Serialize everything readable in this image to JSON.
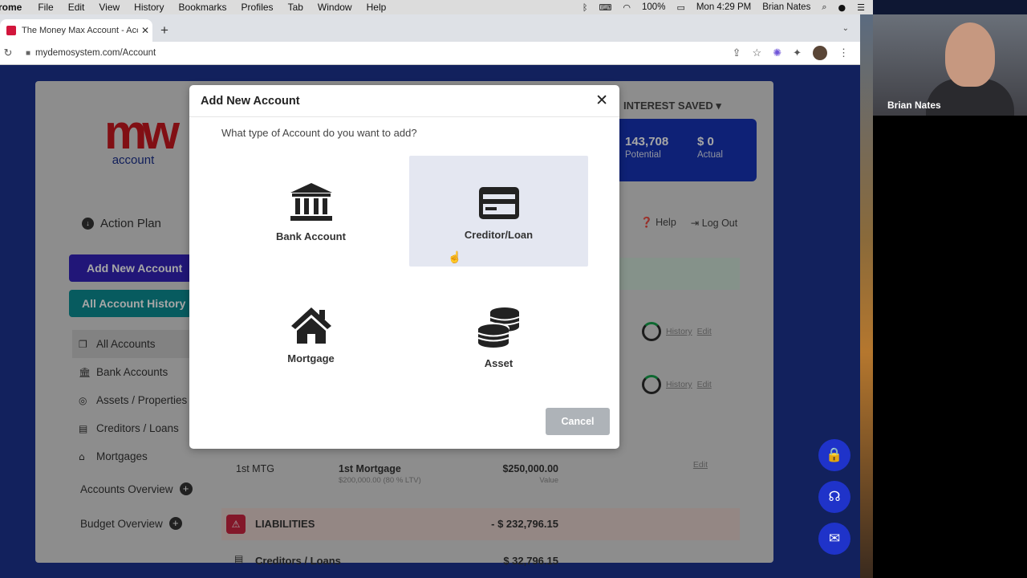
{
  "menubar": {
    "app_name": "Chrome",
    "items": [
      "File",
      "Edit",
      "View",
      "History",
      "Bookmarks",
      "Profiles",
      "Tab",
      "Window",
      "Help"
    ],
    "battery": "100%",
    "clock": "Mon 4:29 PM",
    "user": "Brian Nates"
  },
  "browser": {
    "tab_title": "The Money Max Account - Acc",
    "url": "mydemosystem.com/Account"
  },
  "page": {
    "logo_top": "mw",
    "logo_sub": "account",
    "action_plan": "Action Plan",
    "add_new_account": "Add New Account",
    "all_account_history": "All Account History",
    "nav": [
      {
        "label": "All Accounts",
        "icon": "copy-icon"
      },
      {
        "label": "Bank Accounts",
        "icon": "bank-icon"
      },
      {
        "label": "Assets / Properties",
        "icon": "coins-icon"
      },
      {
        "label": "Creditors / Loans",
        "icon": "card-icon"
      },
      {
        "label": "Mortgages",
        "icon": "home-icon"
      }
    ],
    "accounts_overview": "Accounts Overview",
    "budget_overview": "Budget Overview",
    "interest_saved": "INTEREST SAVED",
    "potential_value": "143,708",
    "potential_label": "Potential",
    "actual_value": "$ 0",
    "actual_label": "Actual",
    "help": "Help",
    "logout": "Log Out",
    "history_link": "History",
    "edit_link": "Edit",
    "mtg_col1": "1st MTG",
    "mtg_name": "1st Mortgage",
    "mtg_sub": "$200,000.00 (80 % LTV)",
    "mtg_value": "$250,000.00",
    "mtg_value_label": "Value",
    "liabilities_label": "LIABILITIES",
    "liabilities_amount": "- $ 232,796.15",
    "creditors_label": "Creditors / Loans",
    "creditors_amount": "$ 32,796.15"
  },
  "modal": {
    "title": "Add New Account",
    "question": "What type of Account do you want to add?",
    "options": [
      {
        "label": "Bank Account",
        "icon": "bank-icon"
      },
      {
        "label": "Creditor/Loan",
        "icon": "credit-card-icon"
      },
      {
        "label": "Mortgage",
        "icon": "house-icon"
      },
      {
        "label": "Asset",
        "icon": "coins-icon"
      }
    ],
    "cancel": "Cancel"
  },
  "video": {
    "participant": "Brian Nates"
  },
  "colors": {
    "primary_purple": "#3322b8",
    "teal": "#0b8d93",
    "brand_red": "#c6171f",
    "brand_blue": "#1a2f8a",
    "stats_blue": "#1634b5"
  }
}
